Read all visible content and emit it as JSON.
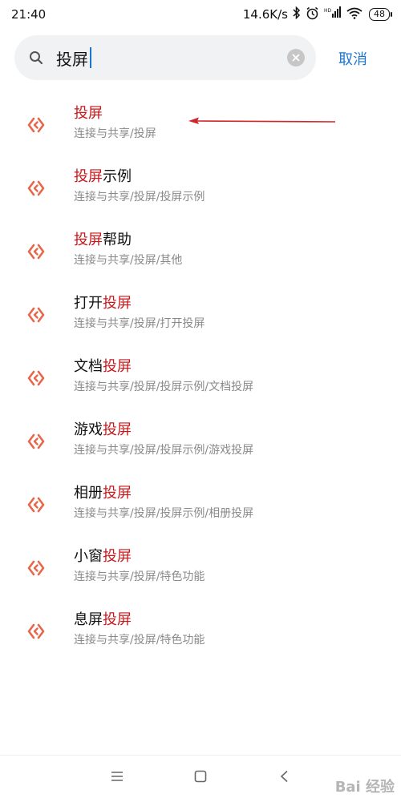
{
  "status_bar": {
    "time": "21:40",
    "network_speed": "14.6K/s",
    "battery": "48",
    "icons": [
      "bluetooth-icon",
      "alarm-icon",
      "hd-signal-icon",
      "wifi-icon",
      "battery-icon"
    ]
  },
  "search": {
    "query": "投屏",
    "cancel_label": "取消"
  },
  "results": [
    {
      "pre": "",
      "hl": "投屏",
      "post": "",
      "path": "连接与共享/投屏"
    },
    {
      "pre": "",
      "hl": "投屏",
      "post": "示例",
      "path": "连接与共享/投屏/投屏示例"
    },
    {
      "pre": "",
      "hl": "投屏",
      "post": "帮助",
      "path": "连接与共享/投屏/其他"
    },
    {
      "pre": "打开",
      "hl": "投屏",
      "post": "",
      "path": "连接与共享/投屏/打开投屏"
    },
    {
      "pre": "文档",
      "hl": "投屏",
      "post": "",
      "path": "连接与共享/投屏/投屏示例/文档投屏"
    },
    {
      "pre": "游戏",
      "hl": "投屏",
      "post": "",
      "path": "连接与共享/投屏/投屏示例/游戏投屏"
    },
    {
      "pre": "相册",
      "hl": "投屏",
      "post": "",
      "path": "连接与共享/投屏/投屏示例/相册投屏"
    },
    {
      "pre": "小窗",
      "hl": "投屏",
      "post": "",
      "path": "连接与共享/投屏/特色功能"
    },
    {
      "pre": "息屏",
      "hl": "投屏",
      "post": "",
      "path": "连接与共享/投屏/特色功能"
    }
  ],
  "colors": {
    "highlight": "#c8171b",
    "accent": "#1a76d2",
    "icon": "#e8674a"
  },
  "watermark": "Bai 经验"
}
